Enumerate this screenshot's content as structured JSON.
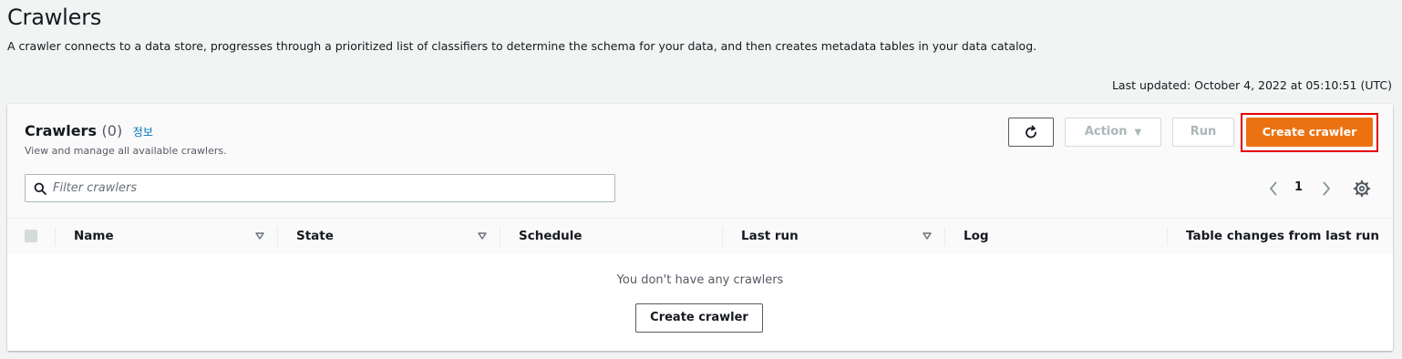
{
  "page": {
    "title": "Crawlers",
    "description": "A crawler connects to a data store, progresses through a prioritized list of classifiers to determine the schema for your data, and then creates metadata tables in your data catalog.",
    "last_updated": "Last updated: October 4, 2022 at 05:10:51 (UTC)"
  },
  "panel": {
    "title": "Crawlers",
    "count": "(0)",
    "info_link": "정보",
    "subtitle": "View and manage all available crawlers.",
    "buttons": {
      "refresh_icon": "refresh-icon",
      "action_label": "Action",
      "run_label": "Run",
      "create_label": "Create crawler"
    },
    "filter": {
      "placeholder": "Filter crawlers",
      "value": ""
    },
    "pagination": {
      "current_page": "1"
    },
    "columns": [
      "Name",
      "State",
      "Schedule",
      "Last run",
      "Log",
      "Table changes from last run"
    ],
    "empty": {
      "message": "You don't have any crawlers",
      "button_label": "Create crawler"
    }
  },
  "colors": {
    "primary": "#ec7211",
    "highlight_border": "#e60000",
    "link": "#0073bb",
    "background": "#f2f3f3"
  }
}
